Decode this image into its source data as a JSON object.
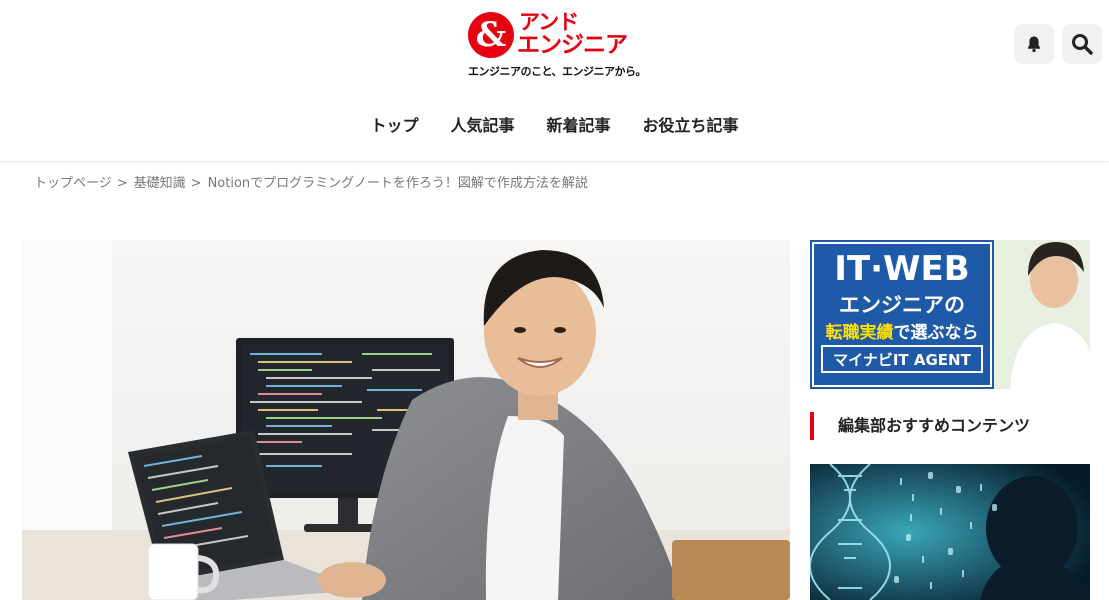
{
  "site": {
    "logo_mark": "&",
    "logo_line1": "アンド",
    "logo_line2": "エンジニア",
    "tagline": "エンジニアのこと、エンジニアから。"
  },
  "header_actions": [
    {
      "name": "bell-icon"
    },
    {
      "name": "search-icon"
    }
  ],
  "gnav": [
    {
      "label": "トップ"
    },
    {
      "label": "人気記事"
    },
    {
      "label": "新着記事"
    },
    {
      "label": "お役立ち記事"
    }
  ],
  "breadcrumb": {
    "items": [
      "トップページ",
      "基礎知識"
    ],
    "current": "Notionでプログラミングノートを作ろう！図解で作成方法を解説",
    "separator": ">"
  },
  "ad_banner": {
    "line1": "IT·WEB",
    "line2": "エンジニアの",
    "line3a": "転職実績",
    "line3b": "で選ぶなら",
    "line4": "マイナビIT AGENT"
  },
  "sidebar": {
    "heading": "編集部おすすめコンテンツ"
  },
  "colors": {
    "brand_red": "#e60012",
    "ad_blue": "#1e5aa8",
    "ad_yellow": "#ffe100"
  }
}
